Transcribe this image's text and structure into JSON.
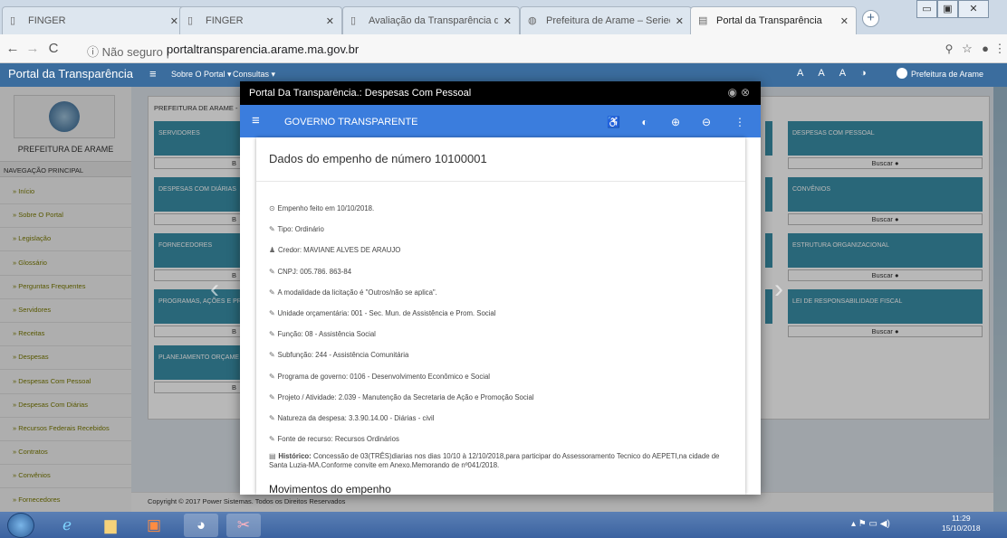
{
  "browser": {
    "tabs": [
      {
        "label": "FINGER",
        "icon": "file-icon"
      },
      {
        "label": "FINGER",
        "icon": "file-icon"
      },
      {
        "label": "Avaliação da Transparência dos",
        "icon": "file-icon"
      },
      {
        "label": "Prefeitura de Arame – Seriedade",
        "icon": "globe-icon"
      },
      {
        "label": "Portal da Transparência",
        "icon": "page-icon",
        "active": true
      }
    ],
    "security_label": "Não seguro",
    "url": "portaltransparencia.arame.ma.gov.br"
  },
  "app_nav": {
    "brand": "Portal da Transparência",
    "links": [
      "Sobre O Portal ▾",
      "Consultas ▾"
    ],
    "a11y": [
      "A",
      "A",
      "A",
      "◑"
    ],
    "prefeitura": "Prefeitura de Arame"
  },
  "sidebar": {
    "title": "PREFEITURA DE ARAME",
    "nav_heading": "NAVEGAÇÃO PRINCIPAL",
    "items": [
      "Início",
      "Sobre O Portal",
      "Legislação",
      "Glossário",
      "Perguntas Frequentes",
      "Servidores",
      "Receitas",
      "Despesas",
      "Despesas Com Pessoal",
      "Despesas Com Diárias",
      "Recursos Federais Recebidos",
      "Contratos",
      "Convênios",
      "Fornecedores"
    ]
  },
  "main": {
    "breadcrumb": "PREFEITURA DE ARAME - PO",
    "left_cards": [
      "SERVIDORES",
      "DESPESAS COM DIÁRIAS",
      "FORNECEDORES",
      "PROGRAMAS, AÇÕES E PR",
      "PLANEJAMENTO ORÇAME"
    ],
    "left_foot": "B",
    "right_cards": [
      "DESPESAS COM PESSOAL",
      "CONVÊNIOS",
      "ESTRUTURA ORGANIZACIONAL",
      "LEI DE RESPONSABILIDADE FISCAL"
    ],
    "right_foot": "Buscar ●",
    "footer": "Copyright © 2017 Power Sistemas. Todos os Direitos Reservados"
  },
  "modal": {
    "window_title": "Portal Da Transparência.: Despesas Com Pessoal",
    "app_title": "GOVERNO TRANSPARENTE",
    "heading": "Dados do empenho de número 10100001",
    "fields": [
      {
        "icon": "⊙",
        "text": "Empenho feito em 10/10/2018."
      },
      {
        "icon": "✎",
        "text": "Tipo: Ordinário"
      },
      {
        "icon": "♟",
        "text": "Credor: MAVIANE ALVES DE ARAUJO"
      },
      {
        "icon": "✎",
        "text": "CNPJ: 005.786. 863-84"
      },
      {
        "icon": "✎",
        "text": "A modalidade da licitação é \"Outros/não se aplica\"."
      },
      {
        "icon": "✎",
        "text": "Unidade orçamentária: 001 - Sec. Mun. de Assistência e Prom. Social"
      },
      {
        "icon": "✎",
        "text": "Função: 08 - Assistência Social"
      },
      {
        "icon": "✎",
        "text": "Subfunção: 244 - Assistência Comunitária"
      },
      {
        "icon": "✎",
        "text": "Programa de governo: 0106 - Desenvolvimento Econômico e Social"
      },
      {
        "icon": "✎",
        "text": "Projeto / Atividade: 2.039 - Manutenção da Secretaria de Ação e Promoção Social"
      },
      {
        "icon": "✎",
        "text": "Natureza da despesa: 3.3.90.14.00 - Diárias - civil"
      },
      {
        "icon": "✎",
        "text": "Fonte de recurso: Recursos Ordinários"
      }
    ],
    "historico_label": "Histórico:",
    "historico_text": "Concessão de 03(TRÊS)diarias nos dias 10/10 à 12/10/2018,para participar do Assessoramento Tecnico do AEPETI,na cidade de Santa Luzia-MA.Conforme convite em Anexo.Memorando de nº041/2018.",
    "movimentos": "Movimentos do empenho"
  },
  "taskbar": {
    "clock_time": "11:29",
    "clock_date": "15/10/2018"
  }
}
